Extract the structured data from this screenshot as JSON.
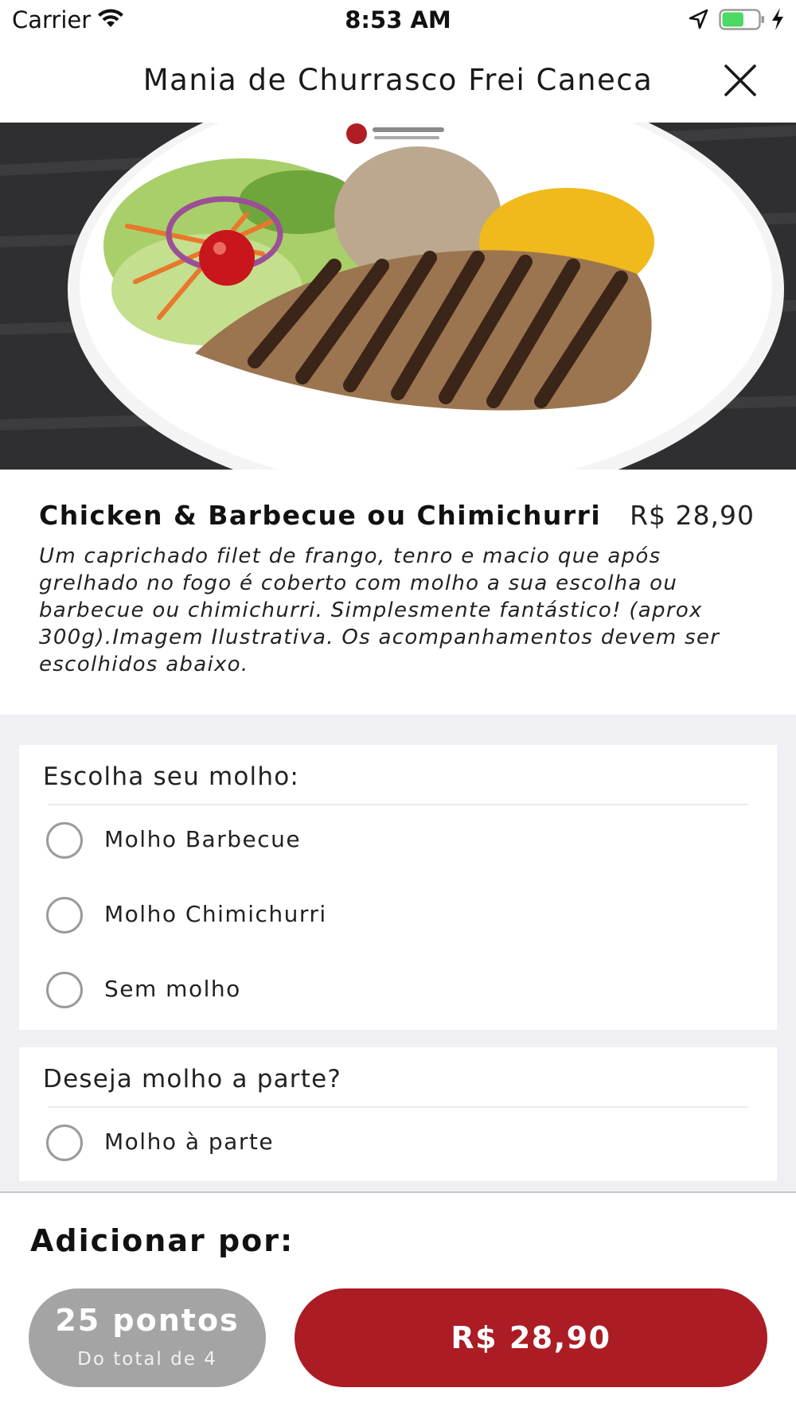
{
  "status_bar": {
    "carrier": "Carrier",
    "time": "8:53 AM",
    "icons": [
      "wifi-icon",
      "location-arrow-icon",
      "battery-icon",
      "charging-bolt-icon"
    ],
    "battery_level": 0.6,
    "battery_color": "#4cd964"
  },
  "nav": {
    "title": "Mania de Churrasco Frei Caneca",
    "close_icon": "close-icon"
  },
  "product": {
    "name": "Chicken & Barbecue ou Chimichurri",
    "price": "R$ 28,90",
    "description": "Um caprichado filet de frango, tenro e macio que após grelhado no fogo é coberto com molho a sua escolha ou barbecue ou chimichurri. Simplesmente fantástico! (aprox 300g).Imagem Ilustrativa. Os acompanhamentos devem ser escolhidos abaixo."
  },
  "option_groups": [
    {
      "title": "Escolha seu molho:",
      "options": [
        "Molho Barbecue",
        "Molho Chimichurri",
        "Sem molho"
      ]
    },
    {
      "title": "Deseja molho a parte?",
      "options": [
        "Molho à parte"
      ]
    }
  ],
  "footer": {
    "add_label": "Adicionar por:",
    "points_button": {
      "main": "25 pontos",
      "sub": "Do total de 4"
    },
    "price_button": {
      "label": "R$ 28,90"
    }
  },
  "colors": {
    "accent": "#ab1c24",
    "points_button": "#a4a4a4",
    "options_background": "#f0f0f4"
  }
}
